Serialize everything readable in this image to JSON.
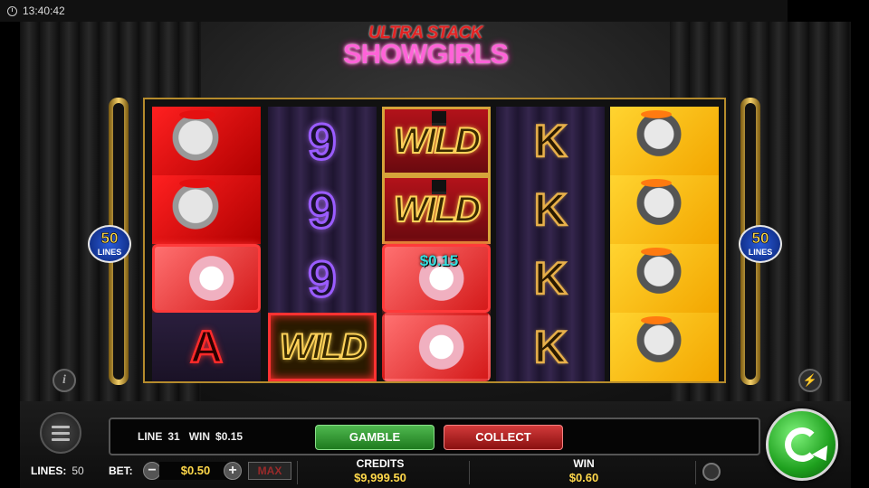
{
  "status": {
    "time": "13:40:42"
  },
  "logo": {
    "top": "ULTRA STACK",
    "main": "SHOWGIRLS"
  },
  "badges": {
    "left_number": "50",
    "left_text": "LINES",
    "right_number": "50",
    "right_text": "LINES"
  },
  "reels": {
    "reel1": [
      "showgirl-red",
      "showgirl-red",
      "showgirl-pink",
      "A"
    ],
    "reel2": [
      "9",
      "9",
      "9",
      "WILD"
    ],
    "reel3": [
      "WILD",
      "WILD",
      "showgirl-pink",
      "showgirl-pink"
    ],
    "reel4": [
      "K",
      "K",
      "K",
      "K"
    ],
    "reel5": [
      "showgirl-yellow",
      "showgirl-yellow",
      "showgirl-yellow",
      "showgirl-yellow"
    ]
  },
  "symbols": {
    "nine": "9",
    "wild": "WILD",
    "k": "K",
    "a": "A"
  },
  "line_win_amount": "$0.15",
  "info_bar": {
    "line_label": "LINE",
    "line_value": "31",
    "win_label": "WIN",
    "win_value": "$0.15"
  },
  "buttons": {
    "gamble": "GAMBLE",
    "collect": "COLLECT",
    "max": "MAX",
    "minus": "−",
    "plus": "+",
    "info": "i"
  },
  "lines": {
    "label": "LINES:",
    "value": "50"
  },
  "bet": {
    "label": "BET:",
    "value": "$0.50"
  },
  "credits": {
    "label": "CREDITS",
    "value": "$9,999.50"
  },
  "win": {
    "label": "WIN",
    "value": "$0.60"
  },
  "colors": {
    "gamble": "#2e8f2e",
    "collect": "#b02020",
    "spin": "#1ea01e",
    "gold": "#ffd84a"
  },
  "icons": [
    "clock-icon",
    "info-icon",
    "lightning-icon",
    "menu-icon",
    "autoplay-icon",
    "spin-icon"
  ]
}
